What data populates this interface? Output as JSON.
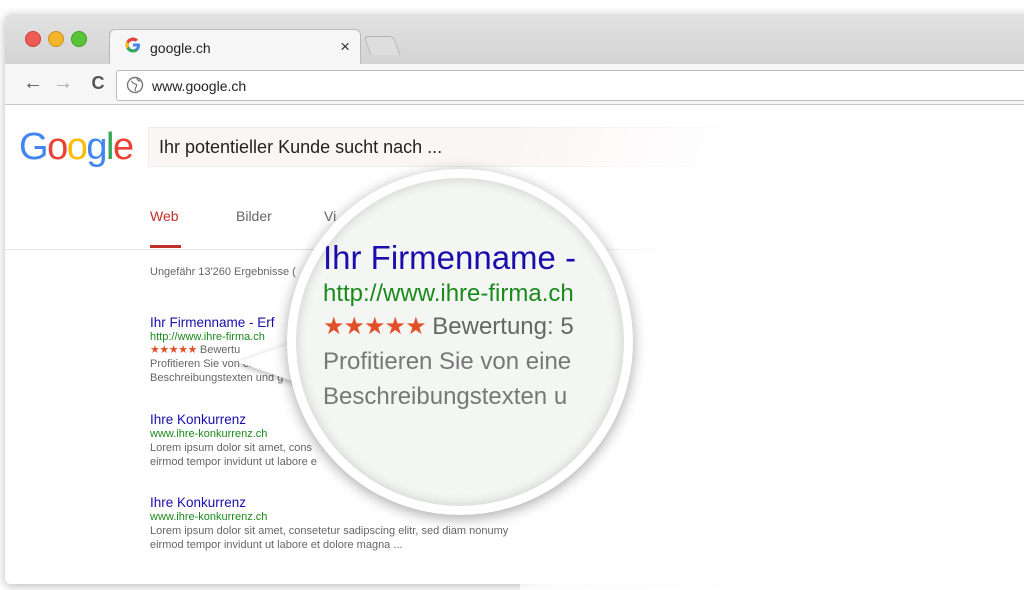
{
  "browser": {
    "tab_title": "google.ch",
    "tab_close": "×",
    "address": "www.google.ch"
  },
  "google": {
    "logo_letters": [
      "G",
      "o",
      "o",
      "g",
      "l",
      "e"
    ],
    "logo_colors": [
      "#4285f4",
      "#ea4335",
      "#fbbc05",
      "#4285f4",
      "#34a853",
      "#ea4335"
    ],
    "search_query": "Ihr potentieller Kunde sucht nach ..."
  },
  "search_tabs": [
    {
      "label": "Web",
      "active": true
    },
    {
      "label": "Bilder",
      "active": false
    },
    {
      "label": "Vi",
      "active": false
    }
  ],
  "results_stats": "Ungefähr 13'260 Ergebnisse (",
  "results": [
    {
      "title": "Ihr Firmenname - Erf",
      "url": "http://www.ihre-firma.ch",
      "stars": "★★★★★",
      "rating": "Bewertu",
      "desc1": "Profitieren Sie von eir",
      "desc2": "Beschreibungstexten und g"
    },
    {
      "title": "Ihre Konkurrenz",
      "url": "www.ihre-konkurrenz.ch",
      "desc1": "Lorem ipsum dolor sit amet, cons",
      "desc2": "eirmod tempor invidunt ut labore e"
    },
    {
      "title": "Ihre Konkurrenz",
      "url": "www.ihre-konkurrenz.ch",
      "desc1": "Lorem ipsum dolor sit amet, consetetur sadipscing elitr, sed diam nonumy",
      "desc2": "eirmod tempor invidunt ut labore et dolore magna ..."
    }
  ],
  "magnified": {
    "title": "Ihr Firmenname -",
    "url": "http://www.ihre-firma.ch",
    "stars": "★★★★★",
    "rating": "Bewertung: 5",
    "desc1": "Profitieren Sie von eine",
    "desc2": "Beschreibungstexten u"
  }
}
